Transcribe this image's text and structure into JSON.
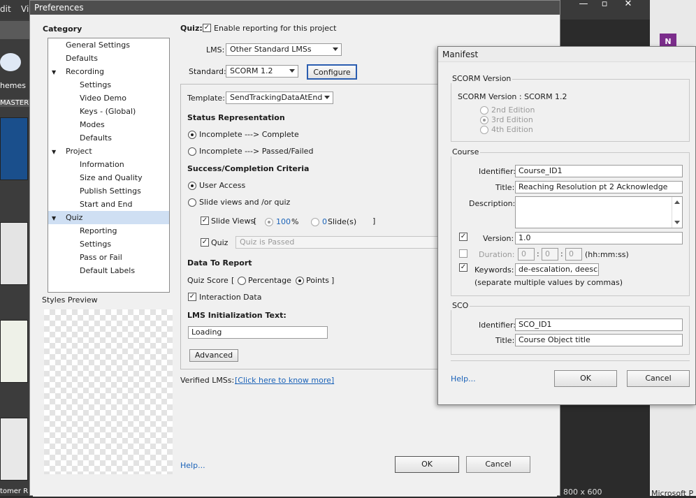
{
  "background": {
    "menu_fragment_left": "dit",
    "menu_fragment_vi": "Vi",
    "left_labels": {
      "themes": "hemes",
      "master": "MASTER"
    },
    "bottom_left": "tomer R",
    "bottom_right_size": "800 x 600",
    "bottom_right_app": "Microsoft P",
    "window_controls": {
      "minimize": "—",
      "maximize": "▫",
      "close": "✕"
    }
  },
  "preferences": {
    "title": "Preferences",
    "category_header": "Category",
    "tree": [
      {
        "label": "General Settings"
      },
      {
        "label": "Defaults"
      },
      {
        "label": "Recording"
      },
      {
        "label": "Settings"
      },
      {
        "label": "Video Demo"
      },
      {
        "label": "Keys - (Global)"
      },
      {
        "label": "Modes"
      },
      {
        "label": "Defaults"
      },
      {
        "label": "Project"
      },
      {
        "label": "Information"
      },
      {
        "label": "Size and Quality"
      },
      {
        "label": "Publish Settings"
      },
      {
        "label": "Start and End"
      },
      {
        "label": "Quiz"
      },
      {
        "label": "Reporting"
      },
      {
        "label": "Settings"
      },
      {
        "label": "Pass or Fail"
      },
      {
        "label": "Default Labels"
      }
    ],
    "styles_preview": "Styles Preview",
    "quiz_label": "Quiz:",
    "enable_reporting": "Enable reporting for this project",
    "lms_label": "LMS:",
    "lms_value": "Other Standard LMSs",
    "standard_label": "Standard:",
    "standard_value": "SCORM 1.2",
    "configure": "Configure",
    "template_label": "Template:",
    "template_value": "SendTrackingDataAtEnd",
    "status_rep": "Status Representation",
    "status_opt1": "Incomplete ---> Complete",
    "status_opt2": "Incomplete ---> Passed/Failed",
    "success_criteria": "Success/Completion Criteria",
    "user_access": "User Access",
    "slide_views_quiz": "Slide views and /or quiz",
    "slide_views": "Slide Views",
    "bracket_open": "[",
    "bracket_close": "]",
    "percent_value": "100",
    "percent_sign": "%",
    "slides_value": "0",
    "slides_label": "Slide(s)",
    "quiz_cb": "Quiz",
    "quiz_select": "Quiz is Passed",
    "data_to_report": "Data To Report",
    "quiz_score": "Quiz Score",
    "percentage": "Percentage",
    "points": "Points",
    "interaction_data": "Interaction Data",
    "lms_init_text": "LMS Initialization Text:",
    "lms_init_value": "Loading",
    "advanced": "Advanced",
    "verified_lms": "Verified LMSs:",
    "verified_link": "[Click here to know more]",
    "help": "Help...",
    "ok": "OK",
    "cancel": "Cancel"
  },
  "manifest": {
    "title": "Manifest",
    "scorm_version_group": "SCORM Version",
    "scorm_version_text": "SCORM Version : SCORM 1.2",
    "editions": [
      "2nd Edition",
      "3rd Edition",
      "4th Edition"
    ],
    "course_group": "Course",
    "identifier_label": "Identifier:",
    "identifier_value": "Course_ID1",
    "title_label": "Title:",
    "title_value": "Reaching Resolution pt 2 Acknowledge",
    "description_label": "Description:",
    "description_value": "",
    "version_label": "Version:",
    "version_value": "1.0",
    "duration_label": "Duration:",
    "duration_h": "0",
    "duration_m": "0",
    "duration_s": "0",
    "duration_sep": ":",
    "duration_format": "(hh:mm:ss)",
    "keywords_label": "Keywords:",
    "keywords_value": "de-escalation, deescala",
    "keywords_hint": "(separate multiple values by commas)",
    "sco_group": "SCO",
    "sco_identifier_label": "Identifier:",
    "sco_identifier_value": "SCO_ID1",
    "sco_title_label": "Title:",
    "sco_title_value": "Course Object title",
    "help": "Help...",
    "ok": "OK",
    "cancel": "Cancel"
  },
  "colors": {
    "selection": "#cfdff3",
    "link": "#1a62b8",
    "title_bar": "#4e4e4e"
  }
}
